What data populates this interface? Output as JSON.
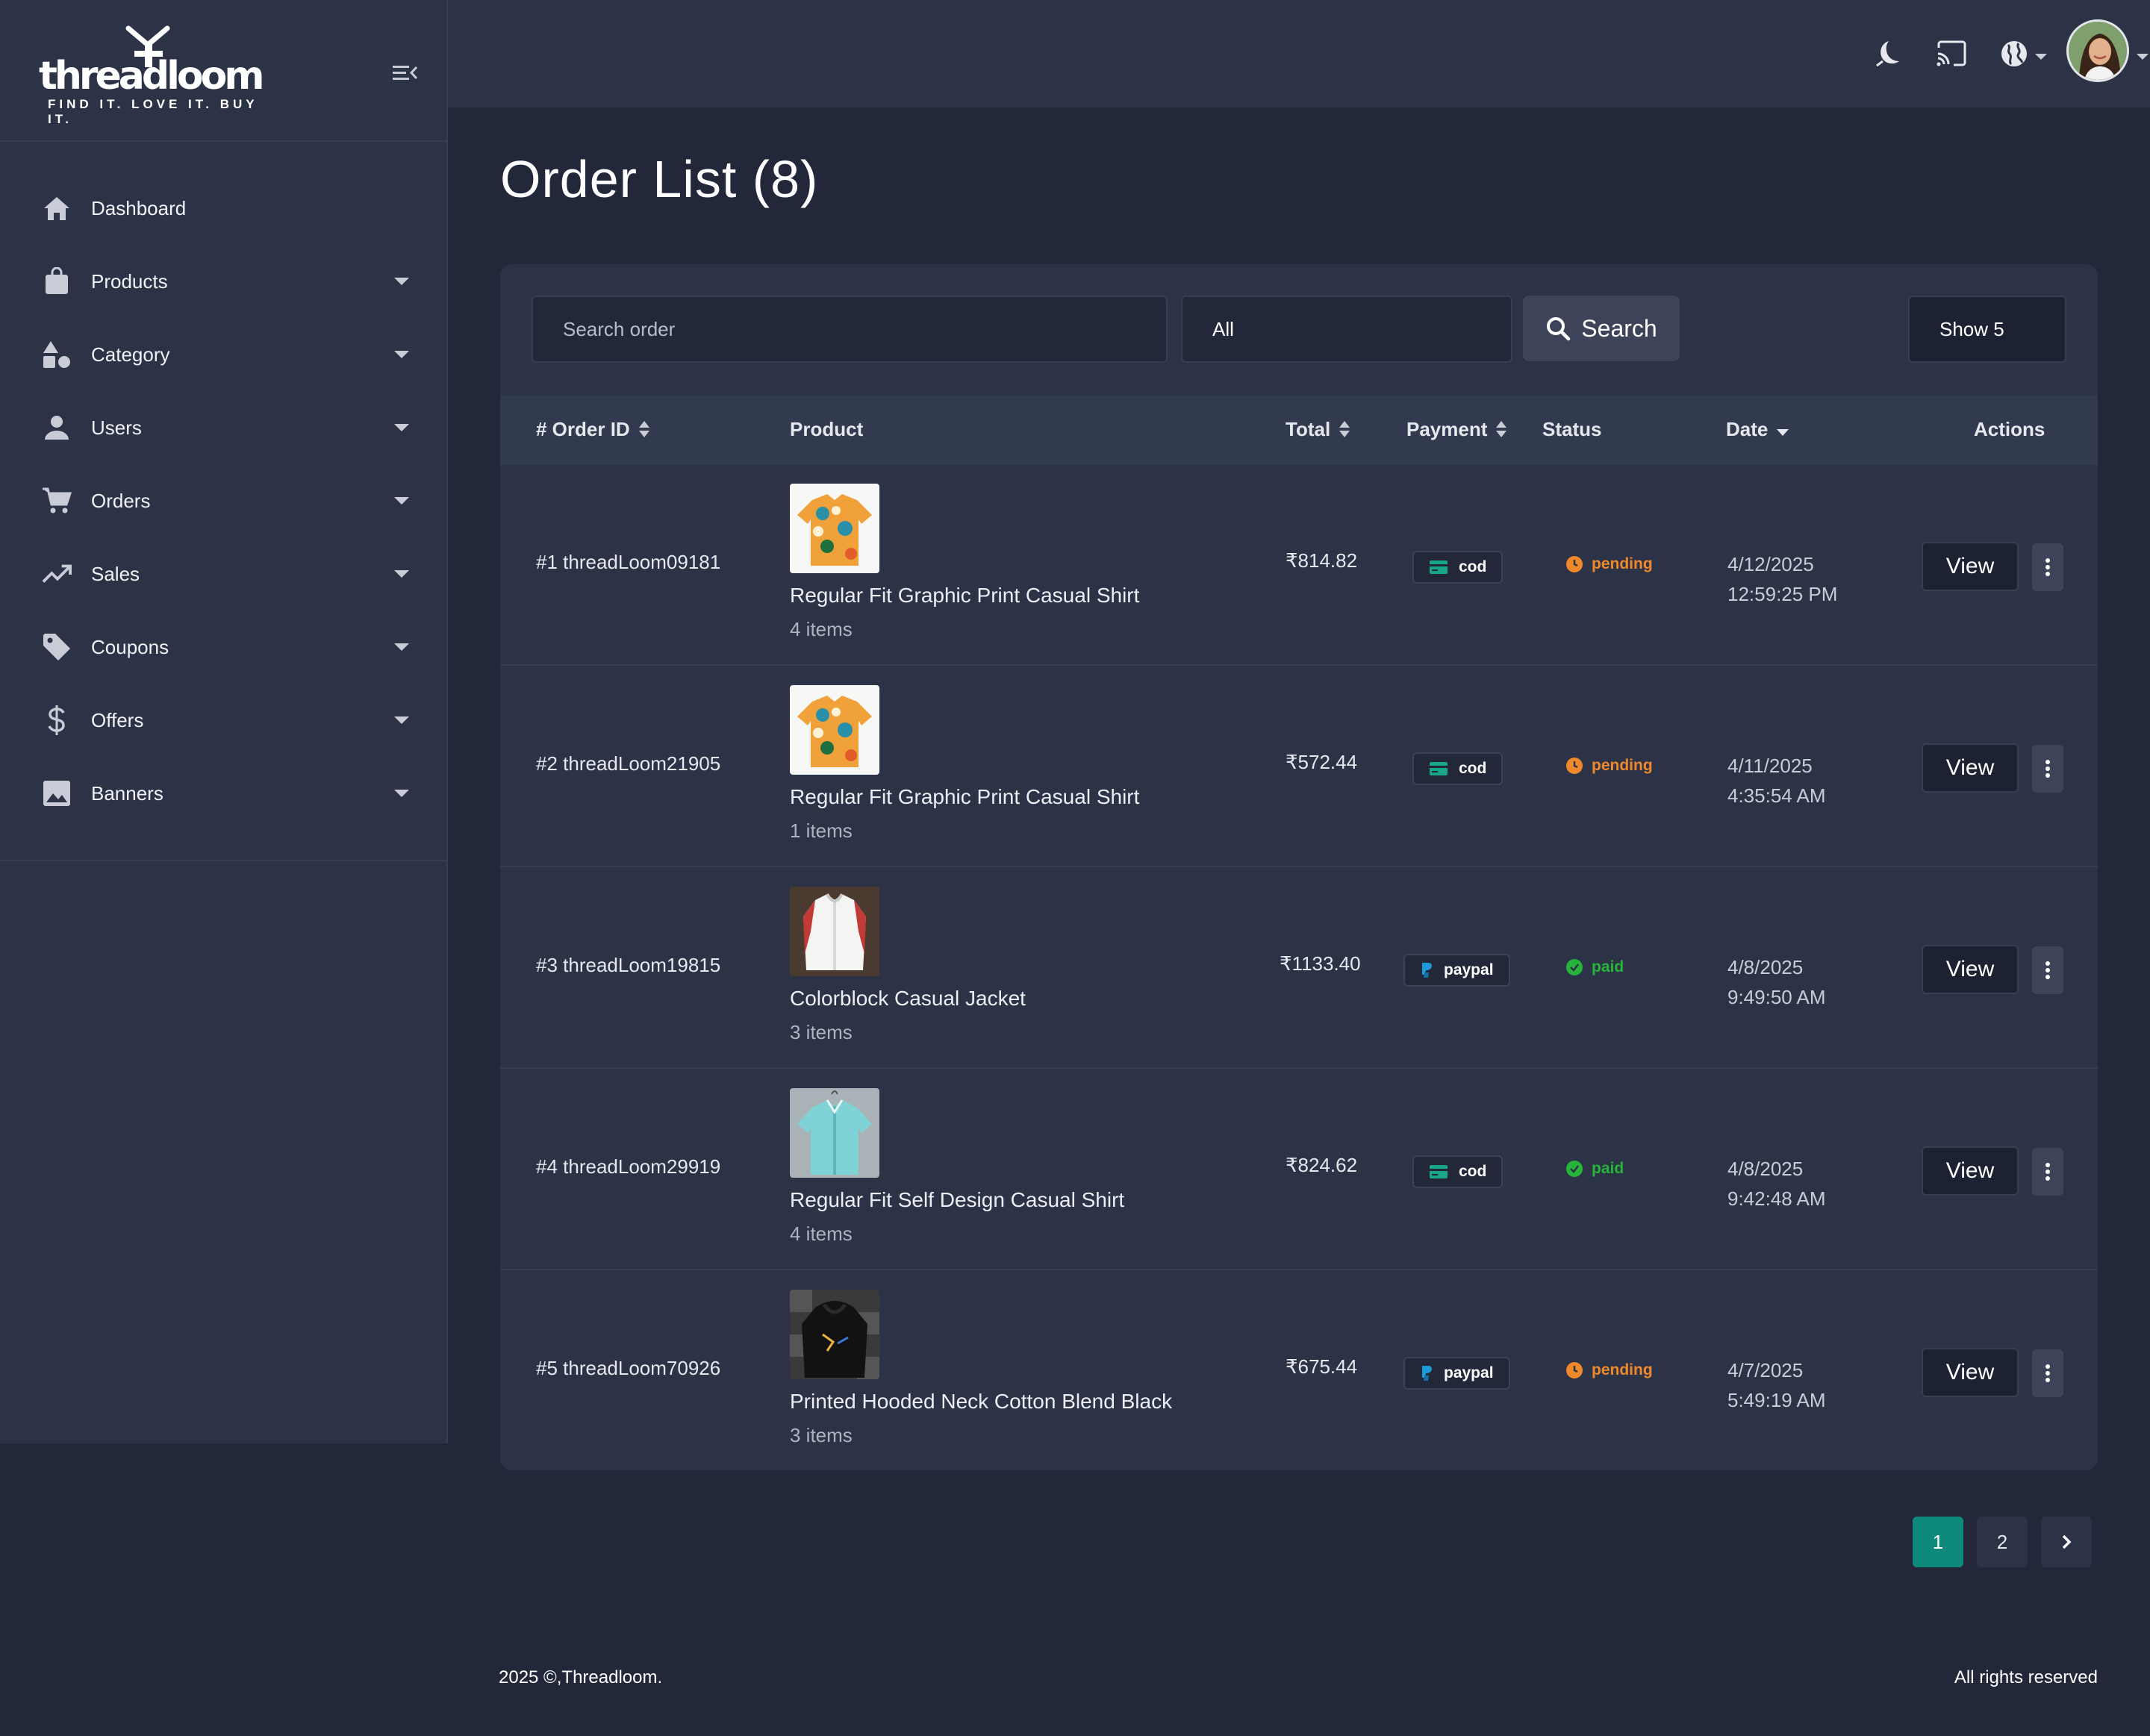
{
  "brand": {
    "logo_word": "threadloom",
    "tagline": "FIND IT. LOVE IT. BUY IT."
  },
  "sidebar": {
    "items": [
      {
        "label": "Dashboard",
        "icon": "home-icon",
        "has_submenu": false
      },
      {
        "label": "Products",
        "icon": "shopping-bag-icon",
        "has_submenu": true
      },
      {
        "label": "Category",
        "icon": "shapes-icon",
        "has_submenu": true
      },
      {
        "label": "Users",
        "icon": "user-icon",
        "has_submenu": true
      },
      {
        "label": "Orders",
        "icon": "cart-icon",
        "has_submenu": true
      },
      {
        "label": "Sales",
        "icon": "trending-up-icon",
        "has_submenu": true
      },
      {
        "label": "Coupons",
        "icon": "tag-icon",
        "has_submenu": true
      },
      {
        "label": "Offers",
        "icon": "dollar-icon",
        "has_submenu": true
      },
      {
        "label": "Banners",
        "icon": "image-icon",
        "has_submenu": true
      }
    ]
  },
  "header": {
    "icons": [
      "moon-icon",
      "cast-icon",
      "globe-icon"
    ]
  },
  "main": {
    "title": "Order List (8)",
    "toolbar": {
      "search_placeholder": "Search order",
      "filter_value": "All",
      "search_label": "Search",
      "show_value": "Show 5"
    },
    "columns": [
      "# Order ID",
      "Product",
      "Total",
      "Payment",
      "Status",
      "Date",
      "Actions"
    ],
    "orders": [
      {
        "id": "#1 threadLoom09181",
        "product": "Regular Fit Graphic Print Casual Shirt",
        "items": "4 items",
        "total": "₹814.82",
        "payment": "cod",
        "status": "pending",
        "date": "4/12/2025",
        "time": "12:59:25 PM",
        "thumb": "floral-shirt"
      },
      {
        "id": "#2 threadLoom21905",
        "product": "Regular Fit Graphic Print Casual Shirt",
        "items": "1 items",
        "total": "₹572.44",
        "payment": "cod",
        "status": "pending",
        "date": "4/11/2025",
        "time": "4:35:54 AM",
        "thumb": "floral-shirt"
      },
      {
        "id": "#3 threadLoom19815",
        "product": "Colorblock Casual Jacket",
        "items": "3 items",
        "total": "₹1133.40",
        "payment": "paypal",
        "status": "paid",
        "date": "4/8/2025",
        "time": "9:49:50 AM",
        "thumb": "white-jacket"
      },
      {
        "id": "#4 threadLoom29919",
        "product": "Regular Fit Self Design Casual Shirt",
        "items": "4 items",
        "total": "₹824.62",
        "payment": "cod",
        "status": "paid",
        "date": "4/8/2025",
        "time": "9:42:48 AM",
        "thumb": "blue-shirt"
      },
      {
        "id": "#5 threadLoom70926",
        "product": "Printed Hooded Neck Cotton Blend Black",
        "items": "3 items",
        "total": "₹675.44",
        "payment": "paypal",
        "status": "pending",
        "date": "4/7/2025",
        "time": "5:49:19 AM",
        "thumb": "black-hoodie"
      }
    ],
    "view_label": "View",
    "pagination": [
      "1",
      "2"
    ]
  },
  "colors": {
    "pending": "#f0892a",
    "paid": "#27b43a",
    "accent": "#0e8a7a",
    "cod_icon": "#18a589",
    "paypal_icon": "#1b9bd8"
  },
  "footer": {
    "left": "2025 ©,Threadloom.",
    "right": "All rights reserved"
  }
}
